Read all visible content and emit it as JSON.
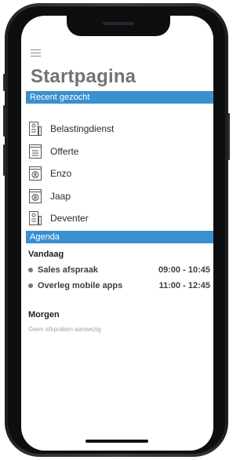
{
  "page": {
    "title": "Startpagina"
  },
  "recent": {
    "header": "Recent gezocht",
    "items": [
      {
        "label": "Belastingdienst",
        "icon": "company-icon"
      },
      {
        "label": "Offerte",
        "icon": "document-icon"
      },
      {
        "label": "Enzo",
        "icon": "contact-card-icon"
      },
      {
        "label": "Jaap",
        "icon": "contact-card-icon"
      },
      {
        "label": "Deventer",
        "icon": "company-icon"
      }
    ]
  },
  "agenda": {
    "header": "Agenda",
    "today": {
      "title": "Vandaag",
      "events": [
        {
          "name": "Sales afspraak",
          "time": "09:00 - 10:45"
        },
        {
          "name": "Overleg mobile apps",
          "time": "11:00 - 12:45"
        }
      ]
    },
    "tomorrow": {
      "title": "Morgen",
      "empty": "Geen afspraken aanwezig"
    }
  },
  "colors": {
    "accent": "#3a8fd0",
    "title": "#737373"
  }
}
